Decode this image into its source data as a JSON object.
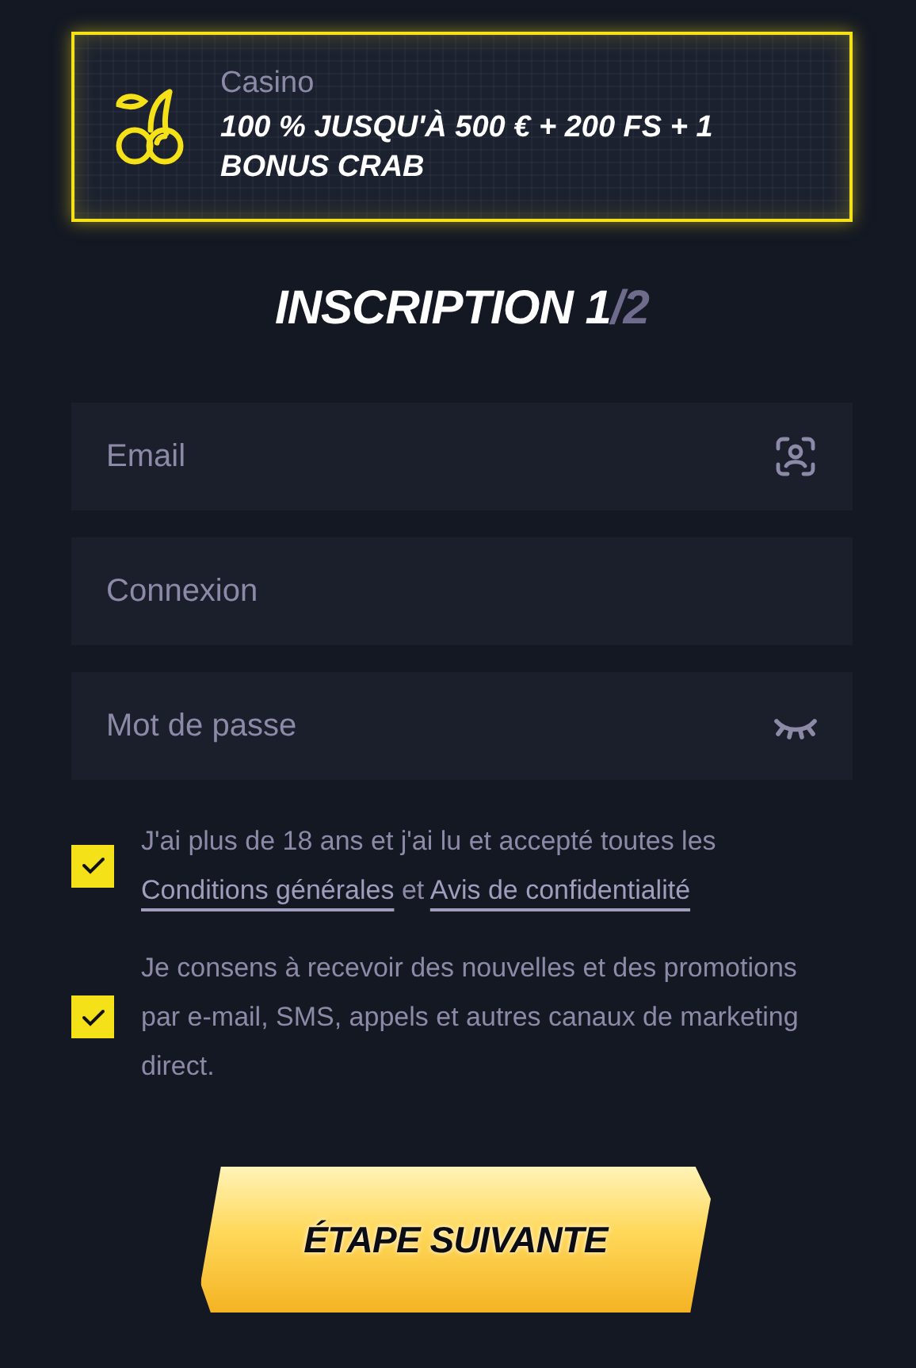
{
  "promo": {
    "category": "Casino",
    "offer": "100 % JUSQU'À 500 € + 200 FS + 1 BONUS CRAB"
  },
  "title": {
    "main": "INSCRIPTION 1",
    "suffix": "/2"
  },
  "fields": [
    {
      "kind": "email",
      "placeholder": "Email"
    },
    {
      "kind": "text",
      "placeholder": "Connexion"
    },
    {
      "kind": "password",
      "placeholder": "Mot de passe"
    }
  ],
  "consents": [
    {
      "checked": true,
      "parts": [
        {
          "kind": "text",
          "text": "J'ai plus de 18 ans et j'ai lu et accepté toutes les "
        },
        {
          "kind": "link",
          "text": "Conditions générales"
        },
        {
          "kind": "text",
          "text": " et "
        },
        {
          "kind": "link",
          "text": "Avis de confidentialité"
        }
      ]
    },
    {
      "checked": true,
      "parts": [
        {
          "kind": "text",
          "text": "Je consens à recevoir des nouvelles et des promotions par e-mail, SMS, appels et autres canaux de marketing direct."
        }
      ]
    }
  ],
  "submit": "ÉTAPE SUIVANTE"
}
